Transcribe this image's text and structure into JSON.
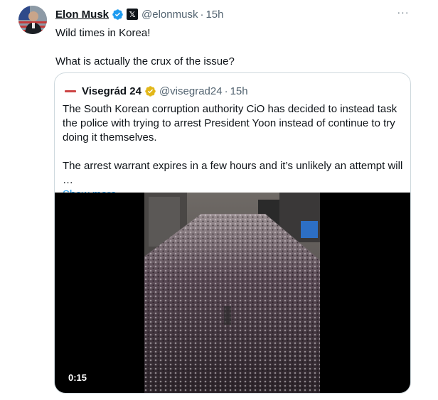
{
  "tweet": {
    "author_name": "Elon Musk",
    "author_handle": "@elonmusk",
    "separator": "·",
    "time": "15h",
    "more_label": "···",
    "x_badge": "𝕏",
    "text_line1": "Wild times in Korea!",
    "text_line2": "What is actually the crux of the issue?"
  },
  "quote": {
    "author_name": "Visegrád 24",
    "author_handle": "@visegrad24",
    "separator": "·",
    "time": "15h",
    "paragraph1": "The South Korean corruption authority CiO has decided to instead task the police with trying to arrest President Yoon instead of continue to try doing it themselves.",
    "paragraph2": "The arrest warrant expires in a few hours and it’s unlikely an attempt will …",
    "show_more": "Show more"
  },
  "video": {
    "duration": "0:15"
  },
  "icons": {
    "verified": "verified-badge-icon",
    "gold_verified": "gold-verified-badge-icon",
    "more": "more-options-icon"
  },
  "colors": {
    "link": "#1d9bf0",
    "secondary_text": "#536471",
    "border": "#cfd9de",
    "verified_blue": "#1d9bf0",
    "gold": "#e2b719"
  }
}
